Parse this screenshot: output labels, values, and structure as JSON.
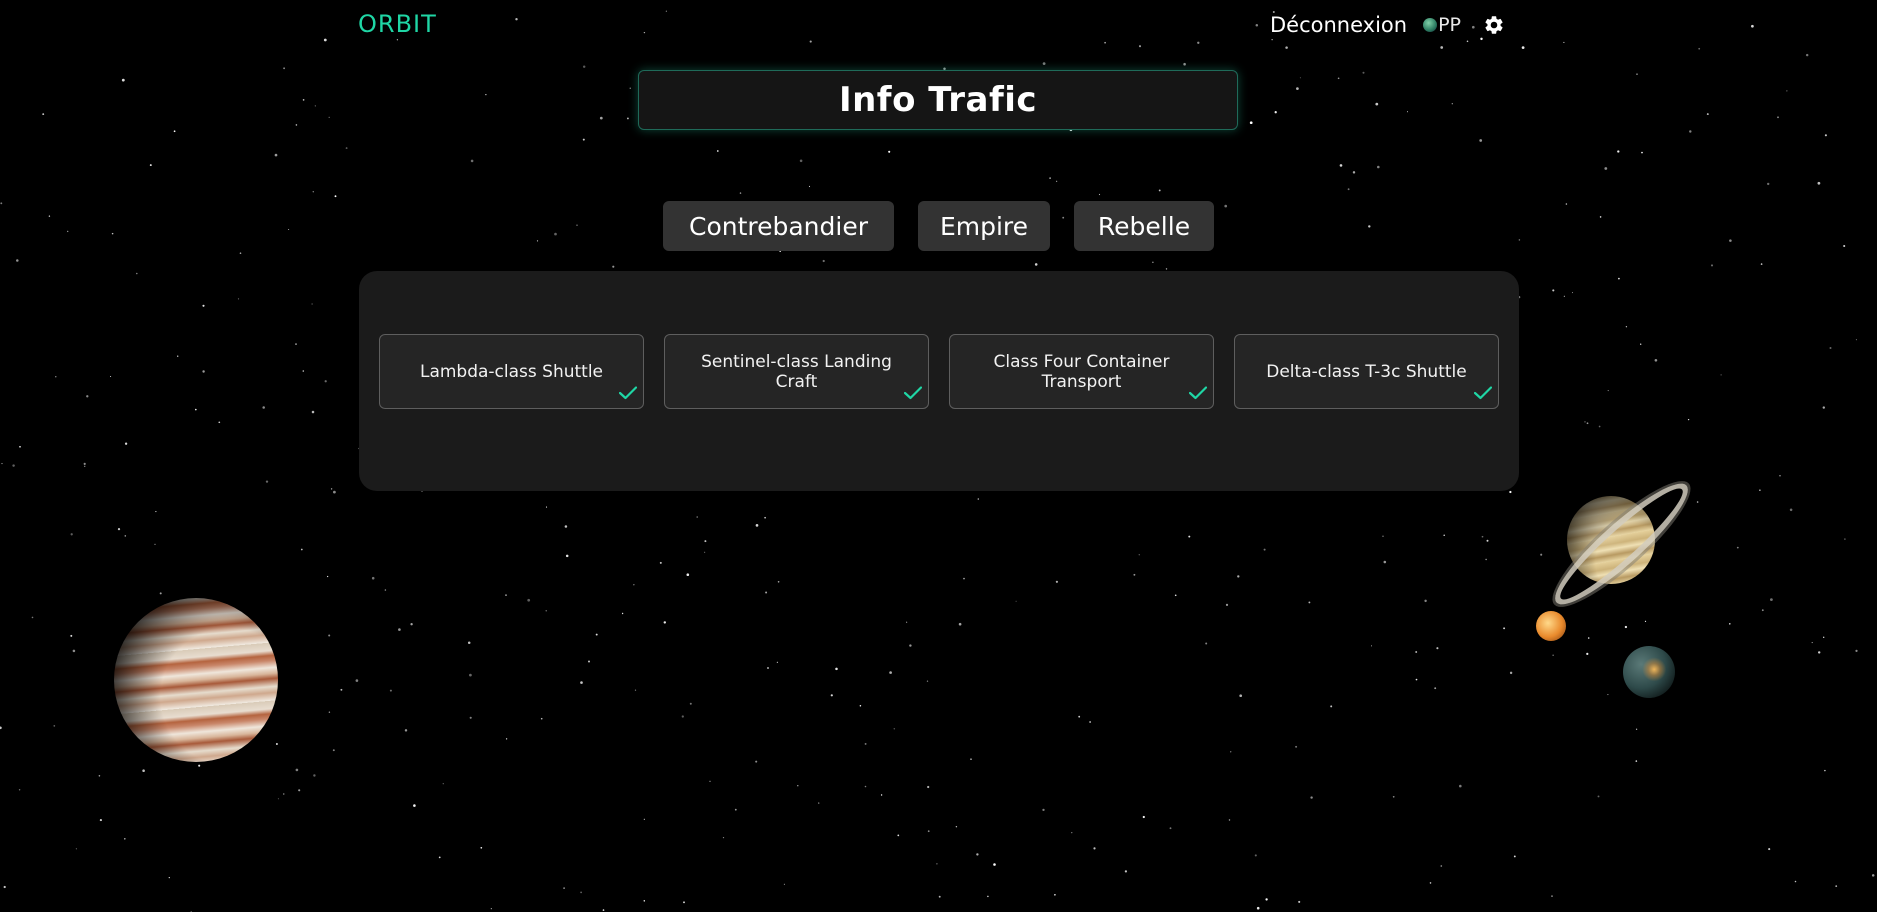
{
  "app": {
    "logo_text": "ORBIT",
    "accent_color": "#1fd6a5"
  },
  "header": {
    "logout_label": "Déconnexion",
    "user_initials": "PP",
    "settings_icon": "gear-icon",
    "avatar_icon": "avatar-image"
  },
  "page": {
    "title": "Info Trafic"
  },
  "filters": [
    {
      "label": "Contrebandier"
    },
    {
      "label": "Empire"
    },
    {
      "label": "Rebelle"
    }
  ],
  "ships": [
    {
      "name": "Lambda-class Shuttle",
      "status_icon": "check-icon",
      "status_color": "#1fd6a5"
    },
    {
      "name": "Sentinel-class Landing Craft",
      "status_icon": "check-icon",
      "status_color": "#1fd6a5"
    },
    {
      "name": "Class Four Container Transport",
      "status_icon": "check-icon",
      "status_color": "#1fd6a5"
    },
    {
      "name": "Delta-class T-3c Shuttle",
      "status_icon": "check-icon",
      "status_color": "#1fd6a5"
    }
  ],
  "decorations": {
    "planets": [
      "jupiter",
      "saturn",
      "small-orange-planet",
      "earth-like-planet"
    ]
  }
}
